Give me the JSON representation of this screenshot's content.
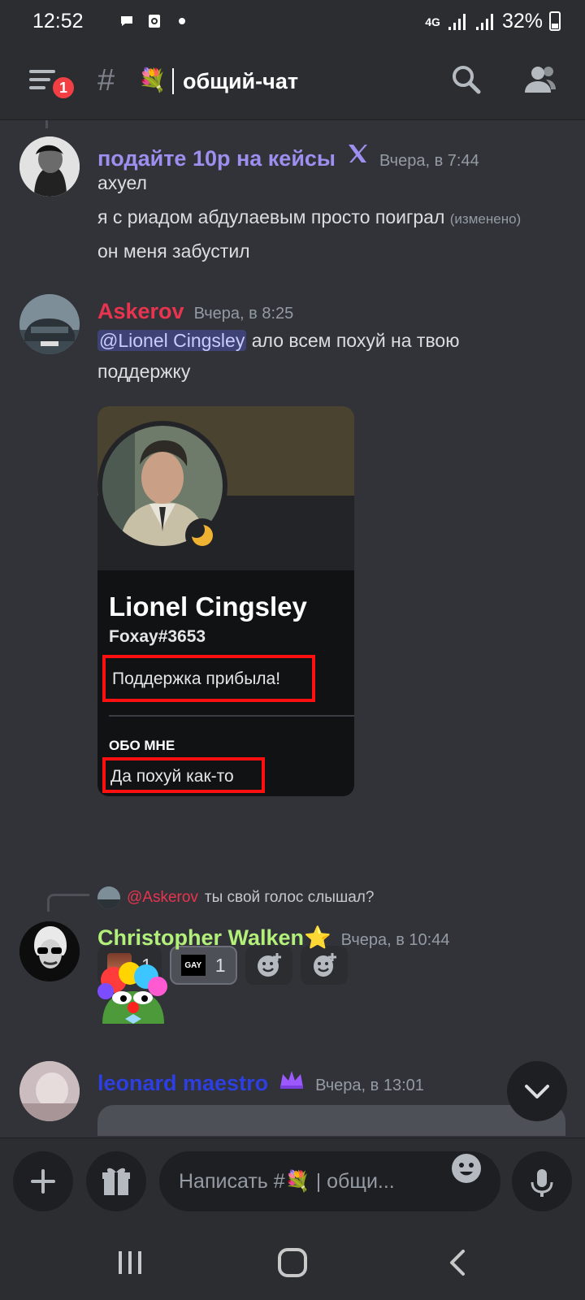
{
  "status_bar": {
    "time": "12:52",
    "network": "4G",
    "battery": "32%"
  },
  "header": {
    "channel_emoji": "💐",
    "channel_name": "общий-чат",
    "notification_count": "1"
  },
  "messages": [
    {
      "author": "подайте 10р на кейсы",
      "author_color": "#9b8ff0",
      "timestamp": "Вчера, в 7:44",
      "lines": [
        "ахуел",
        "я с риадом абдулаевым просто поиграл",
        "он меня забустил"
      ],
      "edited_label": "(изменено)"
    },
    {
      "author": "Askerov",
      "author_color": "#e8344e",
      "timestamp": "Вчера, в 8:25",
      "mention": "@Lionel Cingsley",
      "text_after_mention": "ало всем похуй на твою",
      "text_line2": "поддержку",
      "embed": {
        "name": "Lionel Cingsley",
        "tag": "Foxay#3653",
        "status": "Поддержка прибыла!",
        "about_header": "ОБО МНЕ",
        "about_text": "Да похуй как-то"
      },
      "reactions": [
        {
          "emoji": "face-emoji",
          "count": "1"
        },
        {
          "emoji": "gay-sticker",
          "label": "GAY",
          "count": "1"
        }
      ]
    },
    {
      "reply_to": {
        "author": "@Askerov",
        "text": "ты свой голос слышал?"
      },
      "author": "Christopher Walken⭐",
      "author_color": "#b3f07a",
      "timestamp": "Вчера, в 10:44"
    },
    {
      "author": "leonard maestro",
      "author_color": "#2d3fe0",
      "timestamp": "Вчера, в 13:01"
    }
  ],
  "compose": {
    "placeholder": "Написать #💐 | общи..."
  },
  "colors": {
    "background": "#313338",
    "surface": "#2b2d31",
    "input": "#1e1f22"
  }
}
